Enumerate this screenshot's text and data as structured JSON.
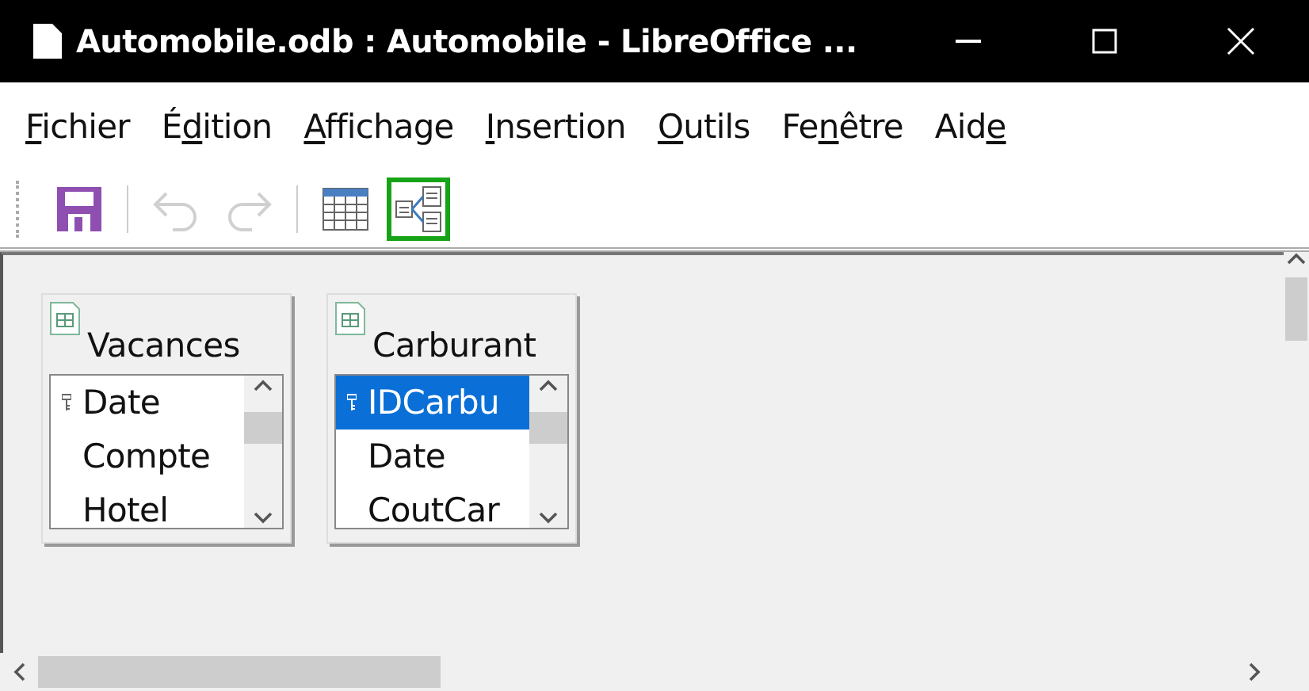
{
  "window": {
    "title": "Automobile.odb : Automobile - LibreOffice ..."
  },
  "menu": [
    {
      "key": "F",
      "post": "ichier"
    },
    {
      "pre": "É",
      "key": "d",
      "post": "ition"
    },
    {
      "key": "A",
      "post": "ffichage"
    },
    {
      "key": "I",
      "post": "nsertion"
    },
    {
      "key": "O",
      "post": "utils"
    },
    {
      "pre": "Fe",
      "key": "n",
      "post": "être"
    },
    {
      "pre": "Aid",
      "key": "e"
    }
  ],
  "toolbar": [
    {
      "kind": "save",
      "disabled": false,
      "selected": false
    },
    {
      "kind": "separator"
    },
    {
      "kind": "undo",
      "disabled": true,
      "selected": false
    },
    {
      "kind": "redo",
      "disabled": true,
      "selected": false
    },
    {
      "kind": "separator"
    },
    {
      "kind": "table",
      "disabled": false,
      "selected": false
    },
    {
      "kind": "relation",
      "disabled": false,
      "selected": true
    }
  ],
  "tables": [
    {
      "name": "Vacances",
      "fields": [
        {
          "name": "Date",
          "key": true,
          "selected": false
        },
        {
          "name": "Compte",
          "key": false,
          "selected": false
        },
        {
          "name": "Hotel",
          "key": false,
          "selected": false
        }
      ]
    },
    {
      "name": "Carburant",
      "fields": [
        {
          "name": "IDCarbu",
          "key": true,
          "selected": true
        },
        {
          "name": "Date",
          "key": false,
          "selected": false
        },
        {
          "name": "CoutCar",
          "key": false,
          "selected": false
        }
      ]
    }
  ]
}
